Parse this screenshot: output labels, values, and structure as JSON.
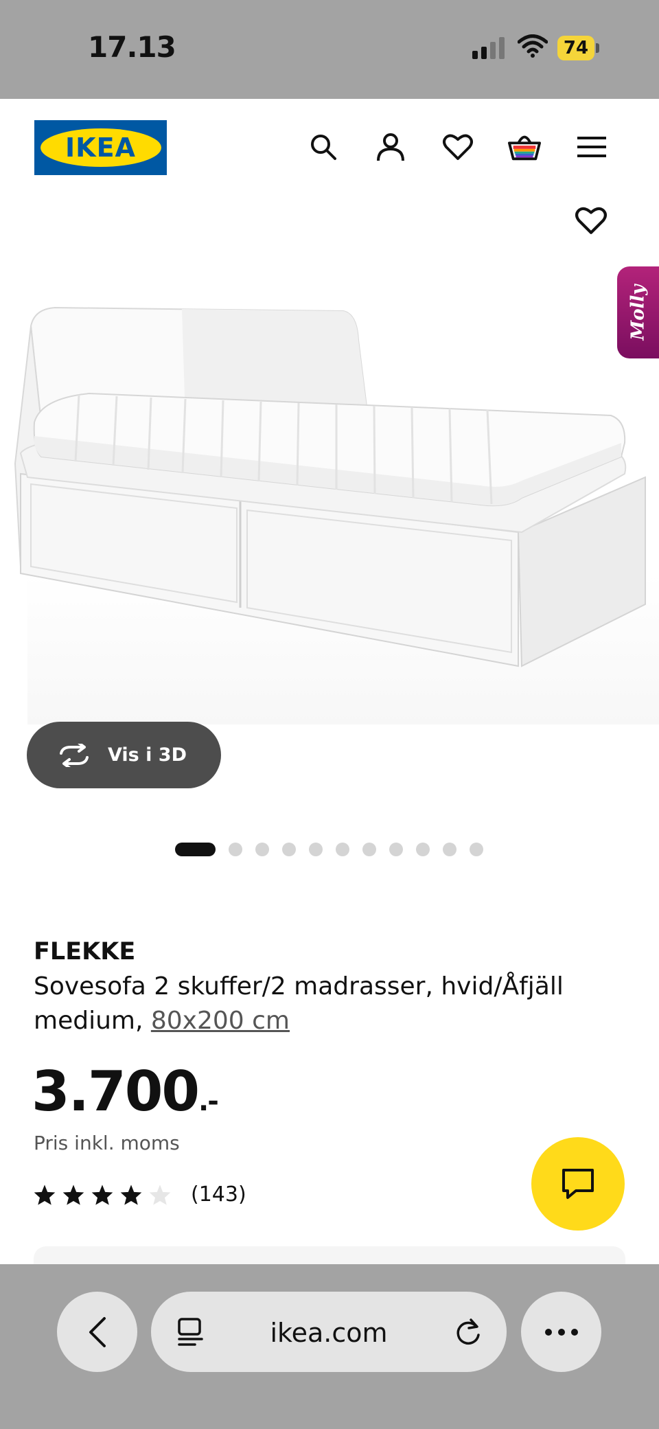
{
  "status_bar": {
    "time": "17.13",
    "battery": "74"
  },
  "header": {
    "logo_text": "IKEA",
    "icons": [
      "search-icon",
      "account-icon",
      "favorites-icon",
      "cart-icon",
      "menu-icon"
    ]
  },
  "side_tab": {
    "label": "Molly"
  },
  "gallery": {
    "view_3d_label": "Vis i 3D",
    "image_count": 11,
    "active_index": 0
  },
  "product": {
    "name": "FLEKKE",
    "description": "Sovesofa 2 skuffer/2 madrasser, hvid/Åfjäll medium,",
    "size_link": "80x200 cm",
    "price": "3.700",
    "price_suffix": ".-",
    "vat_note": "Pris inkl. moms",
    "rating_value": 4,
    "rating_max": 5,
    "review_count": "(143)"
  },
  "browser": {
    "url": "ikea.com"
  },
  "colors": {
    "ikea_blue": "#0058a3",
    "ikea_yellow": "#ffdb00",
    "chat_yellow": "#ffda1a",
    "molly_magenta": "#9b1b6f",
    "system_gray": "#a3a3a3"
  }
}
